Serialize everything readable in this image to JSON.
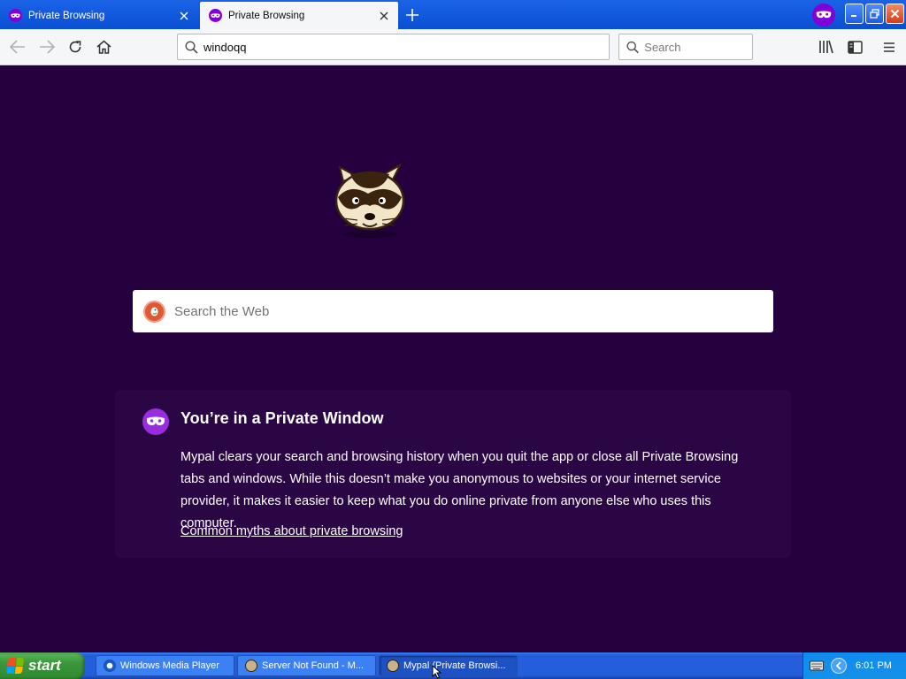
{
  "browser": {
    "tabs": [
      {
        "title": "Private Browsing",
        "active": false
      },
      {
        "title": "Private Browsing",
        "active": true
      }
    ],
    "url": "windoqq",
    "search_placeholder": "Search"
  },
  "page": {
    "web_search_placeholder": "Search the Web",
    "private_title": "You’re in a Private Window",
    "private_body": "Mypal clears your search and browsing history when you quit the app or close all Private Browsing tabs and windows. While this doesn’t make you anonymous to websites or your internet service provider, it makes it easier to keep what you do online private from anyone else who uses this computer.",
    "myths_link": "Common myths about private browsing"
  },
  "taskbar": {
    "start_label": "start",
    "tasks": [
      {
        "label": "Windows Media Player"
      },
      {
        "label": "Server Not Found - M..."
      },
      {
        "label": "Mypal (Private Browsi..."
      }
    ],
    "clock": "6:01 PM"
  },
  "colors": {
    "private_bg": "#25003e",
    "private_purple": "#8000d7",
    "xp_blue": "#245edb",
    "start_green": "#3c963c"
  }
}
